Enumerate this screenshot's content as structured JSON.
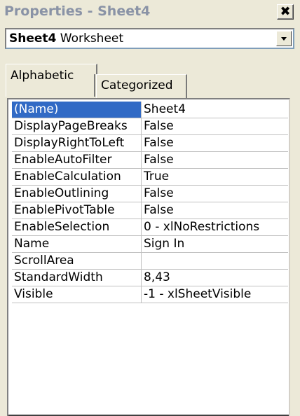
{
  "window": {
    "title": "Properties - Sheet4",
    "close_symbol": "✖"
  },
  "object_combo": {
    "name": "Sheet4",
    "type": "Worksheet"
  },
  "tabs": [
    {
      "label": "Alphabetic",
      "active": true
    },
    {
      "label": "Categorized",
      "active": false
    }
  ],
  "properties": [
    {
      "name": "(Name)",
      "value": "Sheet4"
    },
    {
      "name": "DisplayPageBreaks",
      "value": "False"
    },
    {
      "name": "DisplayRightToLeft",
      "value": "False"
    },
    {
      "name": "EnableAutoFilter",
      "value": "False"
    },
    {
      "name": "EnableCalculation",
      "value": "True"
    },
    {
      "name": "EnableOutlining",
      "value": "False"
    },
    {
      "name": "EnablePivotTable",
      "value": "False"
    },
    {
      "name": "EnableSelection",
      "value": "0 - xlNoRestrictions"
    },
    {
      "name": "Name",
      "value": "Sign In"
    },
    {
      "name": "ScrollArea",
      "value": ""
    },
    {
      "name": "StandardWidth",
      "value": "8,43"
    },
    {
      "name": "Visible",
      "value": "-1 - xlSheetVisible"
    }
  ],
  "colors": {
    "selection": "#316ac5",
    "title_text": "#8a93a6",
    "face": "#ece9d8"
  }
}
